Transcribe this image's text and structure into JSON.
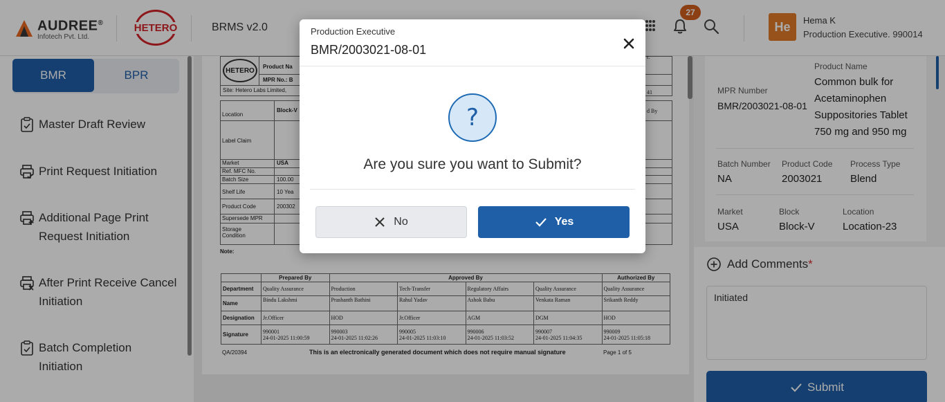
{
  "header": {
    "brand_name": "AUDREE",
    "brand_mark": "®",
    "brand_sub": "Infotech Pvt. Ltd.",
    "client_logo": "HETERO",
    "app_title": "BRMS v2.0",
    "notification_count": "27",
    "user": {
      "initials": "He",
      "name": "Hema K",
      "role": "Production Executive. 990014"
    }
  },
  "sidebar": {
    "toggle": [
      "BMR",
      "BPR"
    ],
    "active_toggle": "BMR",
    "items": [
      {
        "label": "Master Draft Review",
        "icon": "clipboard-check-icon"
      },
      {
        "label": "Print Request Initiation",
        "icon": "printer-check-icon"
      },
      {
        "label": "Additional Page Print Request Initiation",
        "icon": "printer-plus-icon"
      },
      {
        "label": "After Print Receive Cancel Initiation",
        "icon": "printer-x-icon"
      },
      {
        "label": "Batch Completion Initiation",
        "icon": "clipboard-check-icon"
      }
    ]
  },
  "document": {
    "logo": "HETERO",
    "product_name_label": "Product Na",
    "mpr_no_label": "MPR No.: B",
    "site_text": "Site: Hetero Labs Limited,",
    "partial_text": [
      "41",
      "r.",
      "d By"
    ],
    "block_text": "Block-V",
    "rows": [
      {
        "label": "Location",
        "value": ""
      },
      {
        "label": "Label Claim",
        "value": ""
      },
      {
        "label": "Market",
        "value": "USA"
      },
      {
        "label": "Ref. MFC No.",
        "value": ""
      },
      {
        "label": "Batch Size",
        "value": "100.00"
      },
      {
        "label": "Shelf Life",
        "value": "10 Yea"
      },
      {
        "label": "Product Code",
        "value": "200302"
      },
      {
        "label": "Supersede MPR",
        "value": ""
      },
      {
        "label": "Storage Condition",
        "value": ""
      }
    ],
    "note_label": "Note:",
    "sign_headers": {
      "prepared": "Prepared By",
      "approved": "Approved By",
      "authorized": "Authorized By"
    },
    "sign_row_labels": [
      "Department",
      "Name",
      "Designation",
      "Signature"
    ],
    "sign_columns": [
      {
        "department": "Quality Assurance",
        "name": "Bindu  Lakshmi",
        "designation": "Jr.Officer",
        "sig_id": "990001",
        "sig_time": "24-01-2025 11:00:59"
      },
      {
        "department": "Production",
        "name": "Prashanth  Bathini",
        "designation": "HOD",
        "sig_id": "990003",
        "sig_time": "24-01-2025 11:02:26"
      },
      {
        "department": "Tech-Transfer",
        "name": "Rahul  Yadav",
        "designation": "Jr.Officer",
        "sig_id": "990005",
        "sig_time": "24-01-2025 11:03:10"
      },
      {
        "department": "Regulatory Affairs",
        "name": "Ashok  Babu",
        "designation": "AGM",
        "sig_id": "990006",
        "sig_time": "24-01-2025 11:03:52"
      },
      {
        "department": "Quality Assurance",
        "name": "Venkata  Raman",
        "designation": "DGM",
        "sig_id": "990007",
        "sig_time": "24-01-2025 11:04:35"
      },
      {
        "department": "Quality Assurance",
        "name": "Srikanth  Reddy",
        "designation": "HOD",
        "sig_id": "990009",
        "sig_time": "24-01-2025 11:05:18"
      }
    ],
    "footer_code": "QA/20394",
    "footer_text": "This is an electronically generated document which does not require manual signature",
    "footer_page": "Page 1 of 5"
  },
  "details": {
    "product_name_label": "Product Name",
    "product_name": "Common bulk for Acetaminophen Suppositories Tablet 750 mg and 950 mg",
    "mpr_label": "MPR Number",
    "mpr_value": "BMR/2003021-08-01",
    "batch_label": "Batch Number",
    "batch_value": "NA",
    "code_label": "Product Code",
    "code_value": "2003021",
    "process_label": "Process Type",
    "process_value": "Blend",
    "market_label": "Market",
    "market_value": "USA",
    "block_label": "Block",
    "block_value": "Block-V",
    "location_label": "Location",
    "location_value": "Location-23"
  },
  "comments": {
    "title": "Add Comments",
    "required_mark": "*",
    "value": "Initiated",
    "submit_label": "Submit"
  },
  "modal": {
    "subtitle": "Production Executive",
    "title": "BMR/2003021-08-01",
    "question": "Are you sure you want to Submit?",
    "no_label": "No",
    "yes_label": "Yes"
  },
  "colors": {
    "primary": "#1e5fa8",
    "accent_orange": "#e07b28",
    "badge": "#d35f1e",
    "required": "#d32f2f",
    "hetero_red": "#d3242a"
  }
}
